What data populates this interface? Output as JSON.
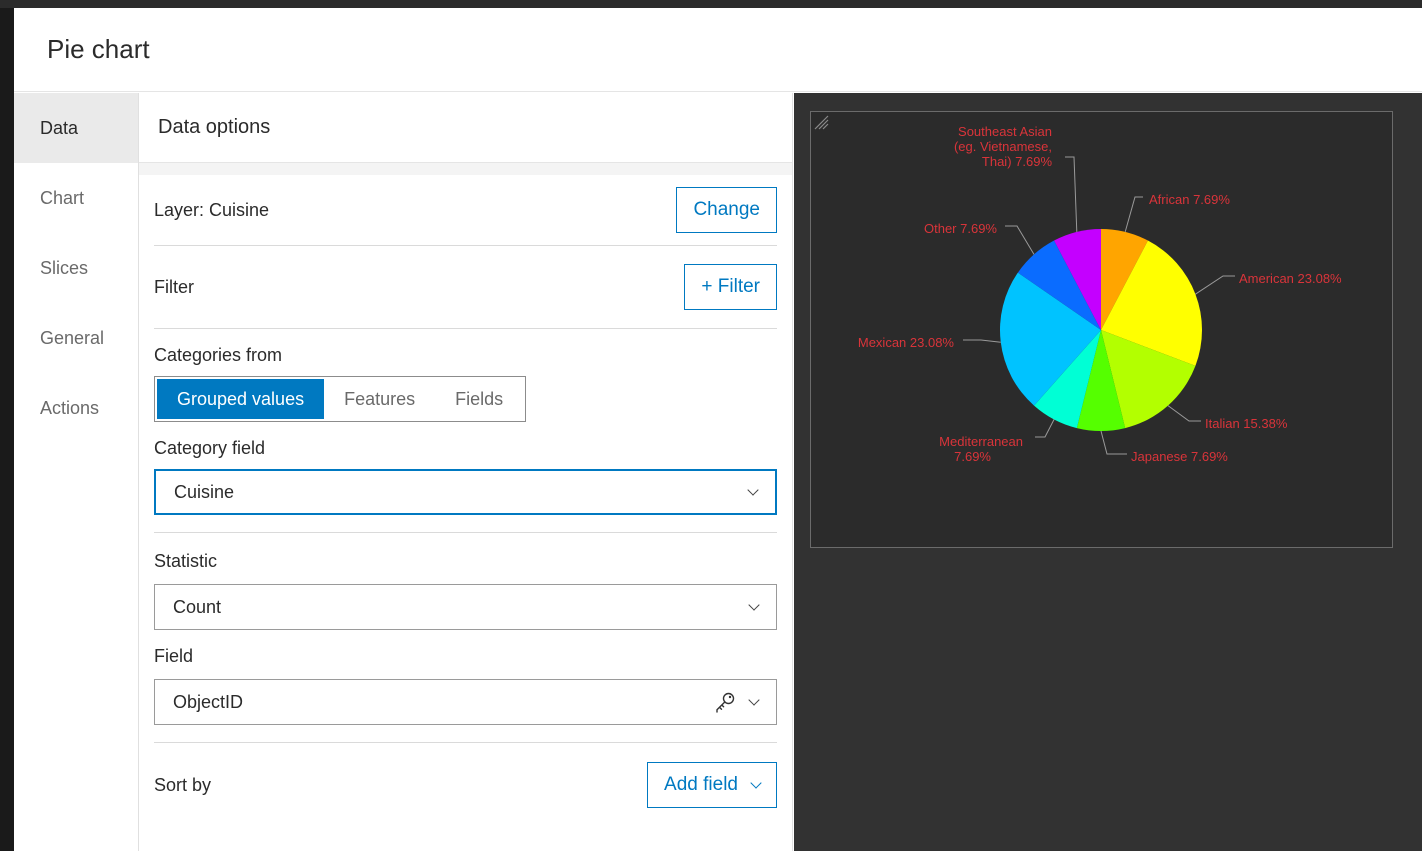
{
  "dialog": {
    "title": "Pie chart"
  },
  "nav": {
    "items": [
      "Data",
      "Chart",
      "Slices",
      "General",
      "Actions"
    ],
    "active": "Data"
  },
  "panel": {
    "heading": "Data options",
    "layer": {
      "label": "Layer: Cuisine",
      "button": "Change"
    },
    "filter": {
      "label": "Filter",
      "button": "+ Filter"
    },
    "categories_from": {
      "label": "Categories from",
      "options": [
        "Grouped values",
        "Features",
        "Fields"
      ],
      "selected": "Grouped values"
    },
    "category_field": {
      "label": "Category field",
      "value": "Cuisine"
    },
    "statistic": {
      "label": "Statistic",
      "value": "Count"
    },
    "field": {
      "label": "Field",
      "value": "ObjectID"
    },
    "sort_by": {
      "label": "Sort by",
      "button": "Add field"
    }
  },
  "colors": {
    "accent": "#0079c1",
    "label_text": "#d9343a",
    "preview_bg": "#323232",
    "chart_bg": "#2b2b2b"
  },
  "chart_data": {
    "type": "pie",
    "slices": [
      {
        "name": "African",
        "percent": 7.69,
        "label": "African 7.69%",
        "color": "#ffa500"
      },
      {
        "name": "American",
        "percent": 23.08,
        "label": "American 23.08%",
        "color": "#ffff00"
      },
      {
        "name": "Italian",
        "percent": 15.38,
        "label": "Italian 15.38%",
        "color": "#b3ff00"
      },
      {
        "name": "Japanese",
        "percent": 7.69,
        "label": "Japanese 7.69%",
        "color": "#55ff00"
      },
      {
        "name": "Mediterranean",
        "percent": 7.69,
        "label": "Mediterranean 7.69%",
        "color": "#00ffd5"
      },
      {
        "name": "Mexican",
        "percent": 23.08,
        "label": "Mexican 23.08%",
        "color": "#00c3ff"
      },
      {
        "name": "Other",
        "percent": 7.69,
        "label": "Other 7.69%",
        "color": "#0a6cff"
      },
      {
        "name": "Southeast Asian (eg. Vietnamese, Thai)",
        "percent": 7.69,
        "label": "Southeast Asian (eg. Vietnamese, Thai) 7.69%",
        "color": "#c400ff"
      }
    ]
  }
}
